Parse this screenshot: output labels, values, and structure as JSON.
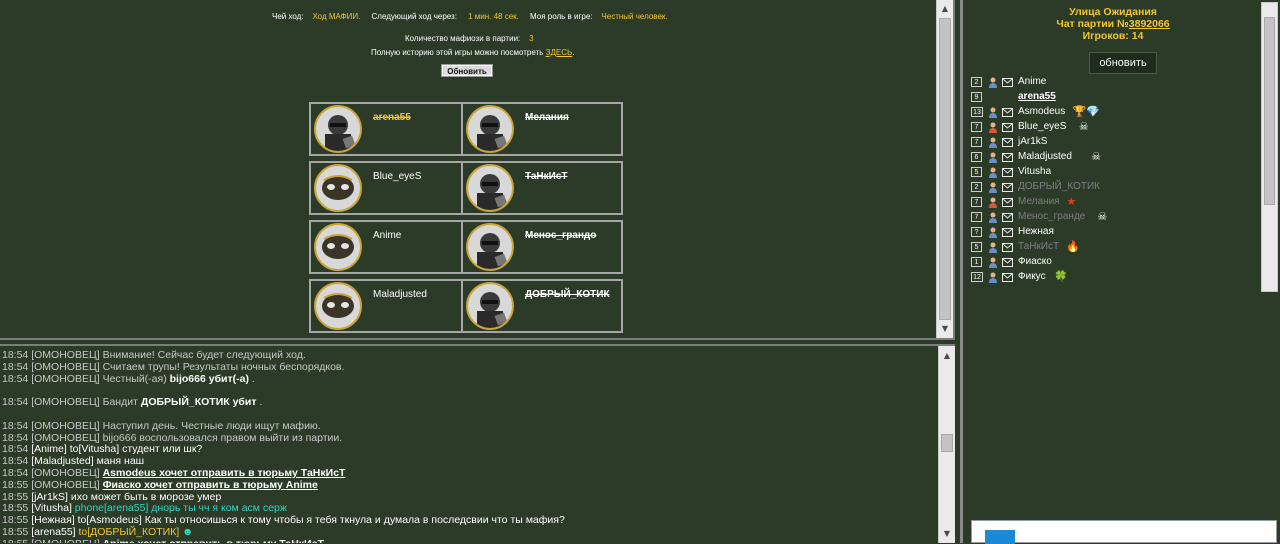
{
  "game": {
    "turn_label": "Чей ход:",
    "turn_value": "Ход МАФИИ.",
    "next_label": "Следующий ход через:",
    "next_value": "1 мин. 48 сек.",
    "role_label": "Моя роль в игре:",
    "role_value": "Честный человек.",
    "mafia_count_label": "Количество мафиози в партии:",
    "mafia_count_value": "3",
    "history_text": "Полную историю этой игры можно посмотреть",
    "history_link": "ЗДЕСЬ",
    "history_dot": ".",
    "refresh_label": "Обновить",
    "players": [
      {
        "name": "arena55",
        "status": "dead-me"
      },
      {
        "name": "Мелания",
        "status": "dead"
      },
      {
        "name": "Blue_eyeS",
        "status": "alive"
      },
      {
        "name": "ТаНкИсТ",
        "status": "dead"
      },
      {
        "name": "Anime",
        "status": "alive"
      },
      {
        "name": "Менос_грандо",
        "status": "dead"
      },
      {
        "name": "Maladjusted",
        "status": "alive"
      },
      {
        "name": "ДОБРЫЙ_КОТИК",
        "status": "dead"
      }
    ]
  },
  "chat": {
    "lines": [
      {
        "time": "18:54",
        "who": "[ОМОНОВЕЦ]",
        "text": "Внимание! Сейчас будет следующий ход."
      },
      {
        "time": "18:54",
        "who": "[ОМОНОВЕЦ]",
        "text": "Считаем трупы! Результаты ночных беспорядков."
      },
      {
        "time": "18:54",
        "who": "[ОМОНОВЕЦ]",
        "text": "Честный(-ая)",
        "bold": "bijo666 убит(-а)",
        "tail": "."
      },
      {
        "blank": true
      },
      {
        "time": "18:54",
        "who": "[ОМОНОВЕЦ]",
        "text": "Бандит",
        "bold": "ДОБРЫЙ_КОТИК убит",
        "tail": "."
      },
      {
        "blank": true
      },
      {
        "time": "18:54",
        "who": "[ОМОНОВЕЦ]",
        "text": "Наступил день. Честные люди ищут мафию."
      },
      {
        "time": "18:54",
        "who": "[ОМОНОВЕЦ]",
        "text": "bijo666 воспользовался правом выйти из партии."
      },
      {
        "time": "18:54",
        "who": "[Anime]",
        "white": "to[Vitusha] студент или шк?"
      },
      {
        "time": "18:54",
        "who": "[Maladjusted]",
        "white": "маня наш"
      },
      {
        "time": "18:54",
        "who": "[ОМОНОВЕЦ]",
        "under": "Asmodeus хочет отправить в тюрьму ТаНкИсТ"
      },
      {
        "time": "18:55",
        "who": "[ОМОНОВЕЦ]",
        "under": "Фиаско хочет отправить в тюрьму Anime"
      },
      {
        "time": "18:55",
        "who": "[jAr1kS]",
        "white": "иxо может быть в морозе умер"
      },
      {
        "time": "18:55",
        "who": "[Vitusha]",
        "cyan": "phone[arena55] днорь ты чч я ком асм серж"
      },
      {
        "time": "18:55",
        "who": "[Нежная]",
        "white": "to[Asmodeus] Как ты относишься к тому чтобы я тебя ткнула и думала в последсвии что ты мафия?"
      },
      {
        "time": "18:55",
        "who": "[arena55]",
        "yellow": "to[ДОБРЫЙ_КОТИК]",
        "emoji": "☻"
      },
      {
        "time": "18:55",
        "who": "[ОМОНОВЕЦ]",
        "under": "Anime хочет отправить в тюрьму ТаНкИсТ"
      }
    ]
  },
  "sidebar": {
    "title": "Улица Ожидания",
    "chat_label": "Чат партии №",
    "chat_number": "3892066",
    "players_label": "Игроков:",
    "players_count": "14",
    "refresh_label": "обновить",
    "players": [
      {
        "count": "2",
        "name": "Anime",
        "badge": ""
      },
      {
        "count": "9",
        "name": "arena55",
        "badge": "",
        "underline": true,
        "noicons": true
      },
      {
        "count": "13",
        "name": "Asmodeus",
        "badge": "🏆💎"
      },
      {
        "count": "7",
        "name": "Blue_eyeS",
        "badge": "☠"
      },
      {
        "count": "7",
        "name": "jAr1kS",
        "badge": ""
      },
      {
        "count": "6",
        "name": "Maladjusted",
        "badge": "☠"
      },
      {
        "count": "5",
        "name": "Vitusha",
        "badge": ""
      },
      {
        "count": "2",
        "name": "ДОБРЫЙ_КОТИК",
        "badge": "",
        "grey": true
      },
      {
        "count": "7",
        "name": "Мелания",
        "badge": "★",
        "grey": true
      },
      {
        "count": "7",
        "name": "Менос_гранде",
        "badge": "☠",
        "grey": true
      },
      {
        "count": "?",
        "name": "Нежная",
        "badge": ""
      },
      {
        "count": "5",
        "name": "ТаНкИсТ",
        "badge": "🔥",
        "grey": true
      },
      {
        "count": "1",
        "name": "Фиаско",
        "badge": ""
      },
      {
        "count": "12",
        "name": "Фикус",
        "badge": "🍀"
      }
    ]
  },
  "colors": {
    "accent": "#f3c532",
    "bg": "#2c3a28",
    "cyan": "#2fd6c8"
  }
}
